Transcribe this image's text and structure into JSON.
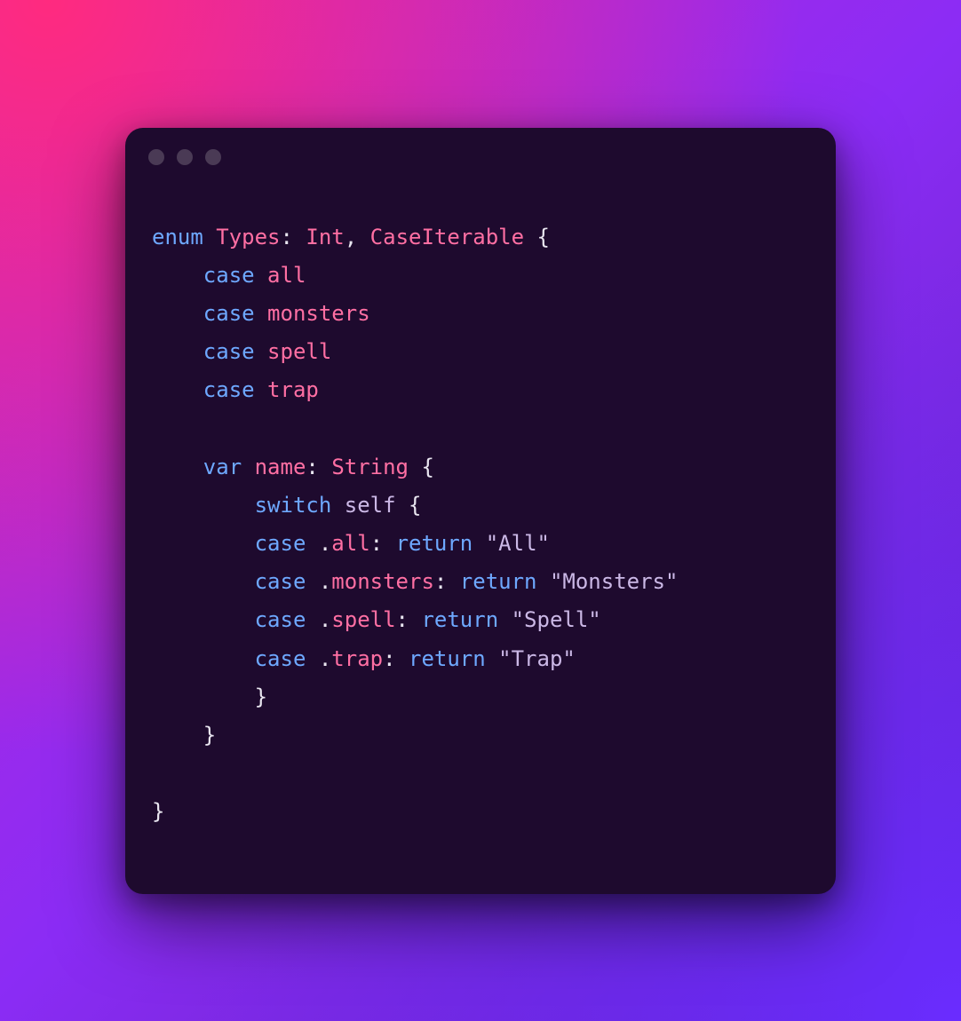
{
  "code": {
    "kw_enum": "enum",
    "types_name": "Types",
    "int_type": "Int",
    "case_iterable": "CaseIterable",
    "kw_case": "case",
    "case_all": "all",
    "case_monsters": "monsters",
    "case_spell": "spell",
    "case_trap": "trap",
    "kw_var": "var",
    "var_name": "name",
    "string_type": "String",
    "kw_switch": "switch",
    "kw_self": "self",
    "dot_all": "all",
    "dot_monsters": "monsters",
    "dot_spell": "spell",
    "dot_trap": "trap",
    "kw_return": "return",
    "str_all": "\"All\"",
    "str_monsters": "\"Monsters\"",
    "str_spell": "\"Spell\"",
    "str_trap": "\"Trap\""
  }
}
